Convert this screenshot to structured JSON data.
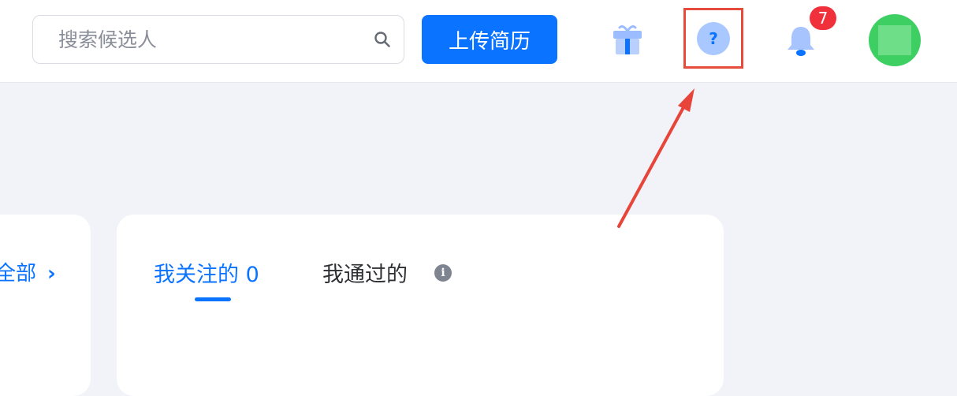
{
  "header": {
    "search": {
      "placeholder": "搜索候选人",
      "icon": "search-icon"
    },
    "upload_button": "上传简历",
    "notification_count": "7",
    "help_symbol": "?",
    "colors": {
      "accent": "#0a73ff",
      "badge": "#f0313b",
      "highlight_box": "#e64b3c"
    }
  },
  "left_card": {
    "view_all_label": "全部",
    "chevron": "›"
  },
  "main_card": {
    "tabs": [
      {
        "label": "我关注的 0",
        "active": true
      },
      {
        "label": "我通过的",
        "active": false
      }
    ],
    "info_symbol": "i"
  }
}
